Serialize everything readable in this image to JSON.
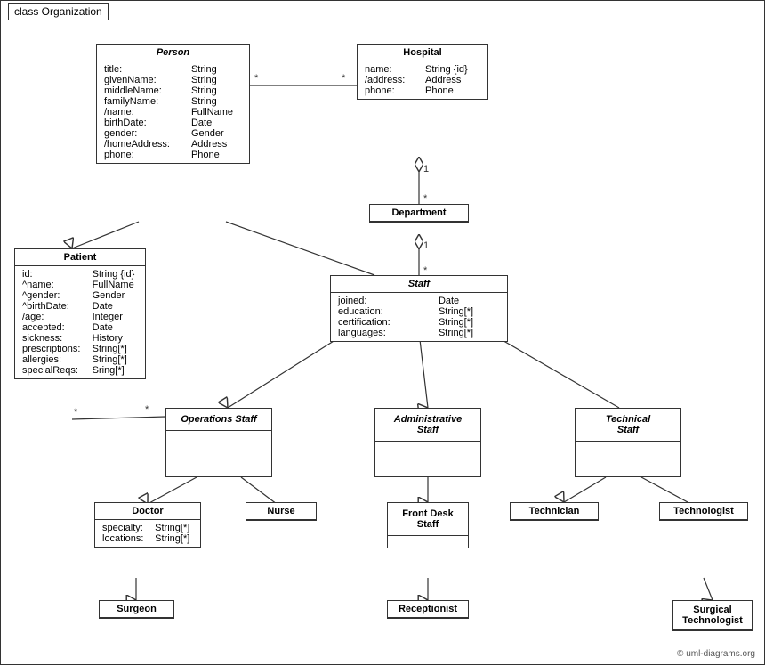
{
  "diagram": {
    "title": "class Organization",
    "classes": {
      "person": {
        "name": "Person",
        "italic": true,
        "attrs": [
          [
            "title:",
            "String"
          ],
          [
            "givenName:",
            "String"
          ],
          [
            "middleName:",
            "String"
          ],
          [
            "familyName:",
            "String"
          ],
          [
            "/name:",
            "FullName"
          ],
          [
            "birthDate:",
            "Date"
          ],
          [
            "gender:",
            "Gender"
          ],
          [
            "/homeAddress:",
            "Address"
          ],
          [
            "phone:",
            "Phone"
          ]
        ]
      },
      "hospital": {
        "name": "Hospital",
        "italic": false,
        "attrs": [
          [
            "name:",
            "String {id}"
          ],
          [
            "/address:",
            "Address"
          ],
          [
            "phone:",
            "Phone"
          ]
        ]
      },
      "department": {
        "name": "Department",
        "italic": false,
        "attrs": []
      },
      "staff": {
        "name": "Staff",
        "italic": true,
        "attrs": [
          [
            "joined:",
            "Date"
          ],
          [
            "education:",
            "String[*]"
          ],
          [
            "certification:",
            "String[*]"
          ],
          [
            "languages:",
            "String[*]"
          ]
        ]
      },
      "patient": {
        "name": "Patient",
        "italic": false,
        "attrs": [
          [
            "id:",
            "String {id}"
          ],
          [
            "^name:",
            "FullName"
          ],
          [
            "^gender:",
            "Gender"
          ],
          [
            "^birthDate:",
            "Date"
          ],
          [
            "/age:",
            "Integer"
          ],
          [
            "accepted:",
            "Date"
          ],
          [
            "sickness:",
            "History"
          ],
          [
            "prescriptions:",
            "String[*]"
          ],
          [
            "allergies:",
            "String[*]"
          ],
          [
            "specialReqs:",
            "Sring[*]"
          ]
        ]
      },
      "operations_staff": {
        "name": "Operations Staff",
        "italic": true
      },
      "administrative_staff": {
        "name": "Administrative Staff",
        "italic": true
      },
      "technical_staff": {
        "name": "Technical Staff",
        "italic": true
      },
      "doctor": {
        "name": "Doctor",
        "italic": false,
        "attrs": [
          [
            "specialty:",
            "String[*]"
          ],
          [
            "locations:",
            "String[*]"
          ]
        ]
      },
      "nurse": {
        "name": "Nurse",
        "italic": false
      },
      "front_desk_staff": {
        "name": "Front Desk Staff",
        "italic": false
      },
      "technician": {
        "name": "Technician",
        "italic": false
      },
      "technologist": {
        "name": "Technologist",
        "italic": false
      },
      "surgeon": {
        "name": "Surgeon",
        "italic": false
      },
      "receptionist": {
        "name": "Receptionist",
        "italic": false
      },
      "surgical_technologist": {
        "name": "Surgical Technologist",
        "italic": false
      }
    },
    "copyright": "© uml-diagrams.org"
  }
}
